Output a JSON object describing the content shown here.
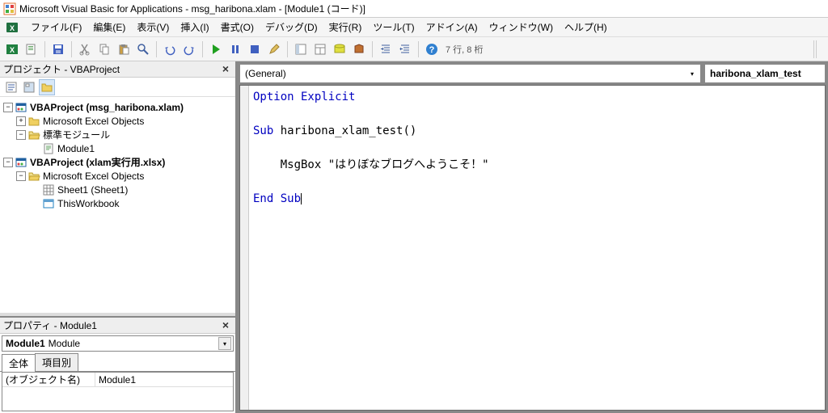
{
  "title": "Microsoft Visual Basic for Applications - msg_haribona.xlam - [Module1 (コード)]",
  "menus": {
    "file": "ファイル(F)",
    "edit": "編集(E)",
    "view": "表示(V)",
    "insert": "挿入(I)",
    "format": "書式(O)",
    "debug": "デバッグ(D)",
    "run": "実行(R)",
    "tools": "ツール(T)",
    "addins": "アドイン(A)",
    "window": "ウィンドウ(W)",
    "help": "ヘルプ(H)"
  },
  "toolbar_status": "7 行, 8 桁",
  "project_panel": {
    "title": "プロジェクト - VBAProject",
    "tree": {
      "proj1": "VBAProject (msg_haribona.xlam)",
      "proj1_folder1": "Microsoft Excel Objects",
      "proj1_folder2": "標準モジュール",
      "proj1_module1": "Module1",
      "proj2": "VBAProject (xlam実行用.xlsx)",
      "proj2_folder1": "Microsoft Excel Objects",
      "proj2_sheet1": "Sheet1 (Sheet1)",
      "proj2_wb": "ThisWorkbook"
    }
  },
  "properties_panel": {
    "title": "プロパティ - Module1",
    "object_label": "Module1",
    "object_type": "Module",
    "tab_all": "全体",
    "tab_cat": "項目別",
    "prop_name_label": "(オブジェクト名)",
    "prop_name_value": "Module1"
  },
  "code": {
    "object_dropdown": "(General)",
    "proc_dropdown": "haribona_xlam_test",
    "lines": {
      "l1_kw": "Option Explicit",
      "l3_kw": "Sub",
      "l3_rest": " haribona_xlam_test()",
      "l5": "    MsgBox \"はりぼなブログへようこそ！\"",
      "l7_kw": "End Sub"
    }
  }
}
